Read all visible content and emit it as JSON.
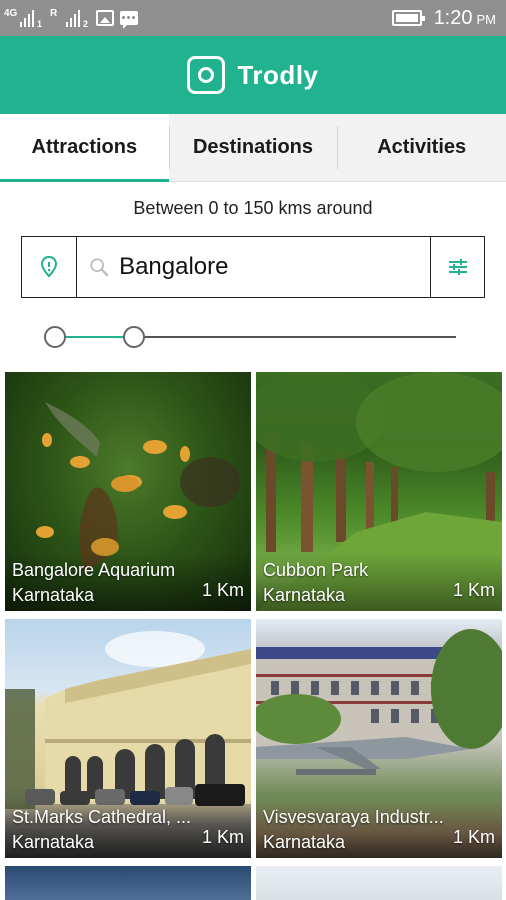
{
  "status_bar": {
    "network_1": "4G",
    "network_1_sub": "1",
    "network_2": "R",
    "network_2_sub": "2",
    "time": "1:20",
    "ampm": "PM"
  },
  "app": {
    "name": "Trodly",
    "accent_color": "#21b38f"
  },
  "tabs": [
    {
      "label": "Attractions",
      "active": true
    },
    {
      "label": "Destinations",
      "active": false
    },
    {
      "label": "Activities",
      "active": false
    }
  ],
  "range_text": "Between 0 to 150 kms around",
  "search": {
    "value": "Bangalore"
  },
  "distance_slider": {
    "min_km": 0,
    "max_km": 150
  },
  "attractions": [
    {
      "name": "Bangalore Aquarium",
      "state": "Karnataka",
      "distance": "1 Km"
    },
    {
      "name": "Cubbon Park",
      "state": "Karnataka",
      "distance": "1 Km"
    },
    {
      "name": "St.Marks Cathedral, ...",
      "state": "Karnataka",
      "distance": "1 Km"
    },
    {
      "name": "Visvesvaraya Industr...",
      "state": "Karnataka",
      "distance": "1 Km"
    }
  ]
}
